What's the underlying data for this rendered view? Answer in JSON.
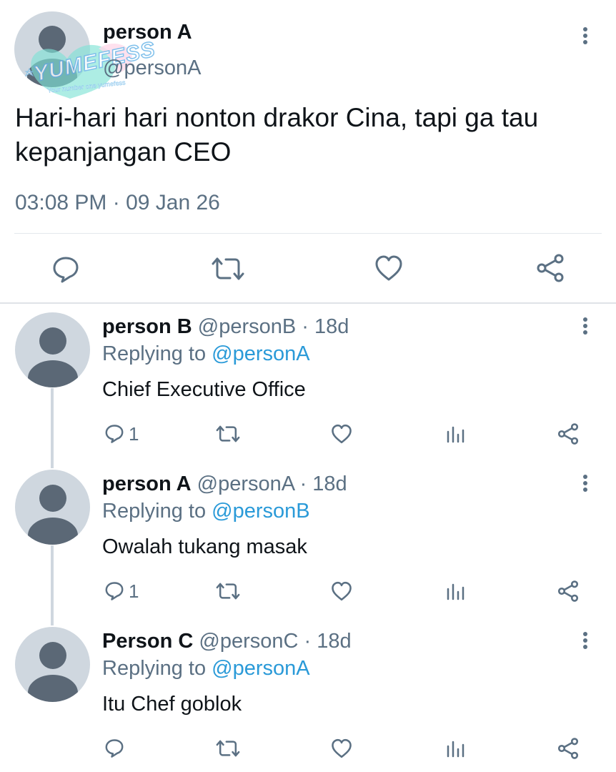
{
  "main_tweet": {
    "name": "person A",
    "handle": "@personA",
    "text_line1": "Hari-hari hari nonton drakor Cina, tapi ga tau",
    "text_line2": "kepanjangan CEO",
    "timestamp": "03:08 PM · 09 Jan 26"
  },
  "watermark": {
    "brand": "YUMEFESS",
    "tagline": "Your number one yumefess"
  },
  "replies": [
    {
      "name": "person B",
      "handle": "@personB · 18d",
      "replying_prefix": "Replying to ",
      "replying_to": "@personA",
      "text": "Chief Executive Office",
      "reply_count": "1"
    },
    {
      "name": "person A",
      "handle": "@personA · 18d",
      "replying_prefix": "Replying to ",
      "replying_to": "@personB",
      "text": "Owalah tukang masak",
      "reply_count": "1"
    },
    {
      "name": "Person C",
      "handle": "@personC · 18d",
      "replying_prefix": "Replying to ",
      "replying_to": "@personA",
      "text": "Itu Chef goblok",
      "reply_count": ""
    }
  ],
  "colors": {
    "text": "#0f1419",
    "muted": "#5b7083",
    "link": "#2a9ad8",
    "avatar_bg": "#cfd7df",
    "avatar_fg": "#5b6876"
  }
}
